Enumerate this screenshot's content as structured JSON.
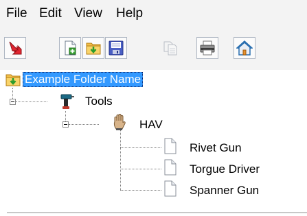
{
  "menu": {
    "file": "File",
    "edit": "Edit",
    "view": "View",
    "help": "Help"
  },
  "toolbar": {
    "buttons": [
      {
        "icon": "exit-arrow-icon"
      },
      {
        "icon": "new-document-icon"
      },
      {
        "icon": "open-folder-icon"
      },
      {
        "icon": "save-disk-icon"
      },
      {
        "icon": "copy-document-icon"
      },
      {
        "icon": "print-icon"
      },
      {
        "icon": "home-icon"
      }
    ]
  },
  "tree": {
    "root": {
      "label": "Example Folder Name",
      "icon": "folder-arrow-icon"
    },
    "tools": {
      "label": "Tools",
      "icon": "drill-icon"
    },
    "hav": {
      "label": "HAV",
      "icon": "hand-icon"
    },
    "items": [
      {
        "label": "Rivet Gun",
        "icon": "document-icon"
      },
      {
        "label": "Torgue Driver",
        "icon": "document-icon"
      },
      {
        "label": "Spanner Gun",
        "icon": "document-icon"
      }
    ]
  },
  "colors": {
    "selection": "#3399ff",
    "chrome": "#f3f3f3"
  }
}
